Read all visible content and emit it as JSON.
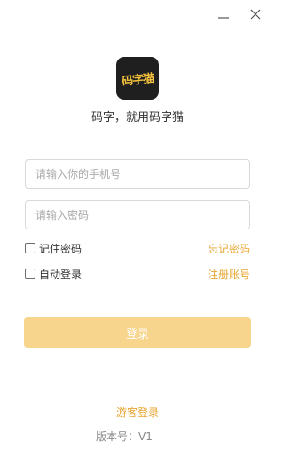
{
  "window": {
    "minimize_icon": "minimize-icon",
    "close_icon": "close-icon"
  },
  "logo": {
    "text": "码字猫"
  },
  "slogan": "码字，就用码字猫",
  "form": {
    "phone_placeholder": "请输入你的手机号",
    "password_placeholder": "请输入密码",
    "remember_label": "记住密码",
    "forgot_link": "忘记密码",
    "auto_login_label": "自动登录",
    "register_link": "注册账号",
    "login_button": "登录"
  },
  "footer": {
    "guest_login": "游客登录",
    "version": "版本号：V1"
  },
  "colors": {
    "accent": "#e8a531",
    "button": "#f8d58d",
    "logo_bg": "#1f1f1f",
    "logo_text": "#f2c13b"
  }
}
